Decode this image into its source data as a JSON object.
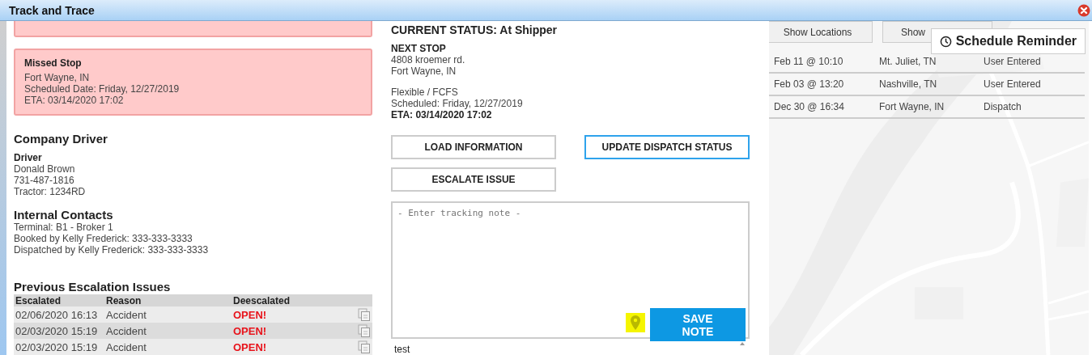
{
  "window": {
    "title": "Track and Trace"
  },
  "alerts": [
    {
      "kind": "partial"
    },
    {
      "kind": "full",
      "title": "Missed Stop",
      "lines": [
        "Fort Wayne, IN",
        "Scheduled Date: Friday, 12/27/2019",
        "ETA: 03/14/2020 17:02"
      ]
    }
  ],
  "driver": {
    "heading": "Company Driver",
    "label": "Driver",
    "lines": [
      "Donald Brown",
      "731-487-1816",
      "Tractor: 1234RD"
    ]
  },
  "contacts": {
    "heading": "Internal Contacts",
    "lines": [
      "Terminal: B1 - Broker 1",
      "Booked by Kelly Frederick: 333-333-3333",
      "Dispatched by Kelly Frederick: 333-333-3333"
    ]
  },
  "escalations": {
    "heading": "Previous Escalation Issues",
    "columns": [
      "Escalated",
      "Reason",
      "Deescalated"
    ],
    "rows": [
      {
        "escalated": "02/06/2020 16:13",
        "reason": "Accident",
        "deescalated": "OPEN!"
      },
      {
        "escalated": "02/03/2020 15:19",
        "reason": "Accident",
        "deescalated": "OPEN!"
      },
      {
        "escalated": "02/03/2020 15:19",
        "reason": "Accident",
        "deescalated": "OPEN!"
      }
    ]
  },
  "status": {
    "current": "CURRENT STATUS: At Shipper",
    "next_stop_label": "NEXT STOP",
    "address": [
      "4808 kroemer rd.",
      "Fort Wayne, IN"
    ],
    "schedule": [
      "Flexible / FCFS",
      "Scheduled: Friday, 12/27/2019"
    ],
    "eta": "ETA: 03/14/2020 17:02"
  },
  "actions": [
    {
      "label": "LOAD INFORMATION",
      "selected": false
    },
    {
      "label": "UPDATE DISPATCH STATUS",
      "selected": true
    },
    {
      "label": "ESCALATE ISSUE",
      "selected": false
    }
  ],
  "note": {
    "placeholder": "- Enter tracking note -",
    "save": "SAVE NOTE"
  },
  "notes_list": [
    "test"
  ],
  "map_buttons": [
    "Show Locations",
    "Show"
  ],
  "reminder": "Schedule Reminder",
  "locations": [
    {
      "time": "Feb 11 @ 10:10",
      "place": "Mt. Juliet, TN",
      "source": "User Entered"
    },
    {
      "time": "Feb 03 @ 13:20",
      "place": "Nashville, TN",
      "source": "User Entered"
    },
    {
      "time": "Dec 30 @ 16:34",
      "place": "Fort Wayne, IN",
      "source": "Dispatch"
    }
  ]
}
